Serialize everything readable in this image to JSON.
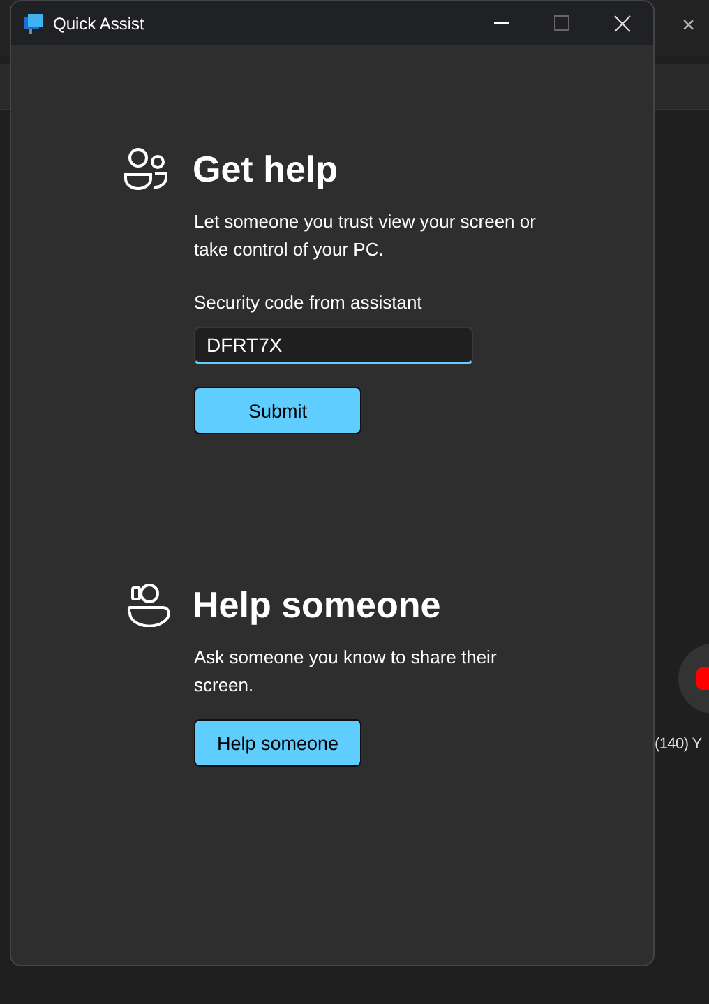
{
  "window": {
    "title": "Quick Assist"
  },
  "sections": [
    {
      "kind": "get_help",
      "title": "Get help",
      "description": "Let someone you trust view your screen or take control of your PC.",
      "field_label": "Security code from assistant",
      "code": "DFRT7X",
      "button": "Submit"
    },
    {
      "kind": "help_someone",
      "title": "Help someone",
      "description": "Ask someone you know to share their screen.",
      "button": "Help someone"
    }
  ],
  "background": {
    "close": "×",
    "video_title": "(140) Y"
  }
}
